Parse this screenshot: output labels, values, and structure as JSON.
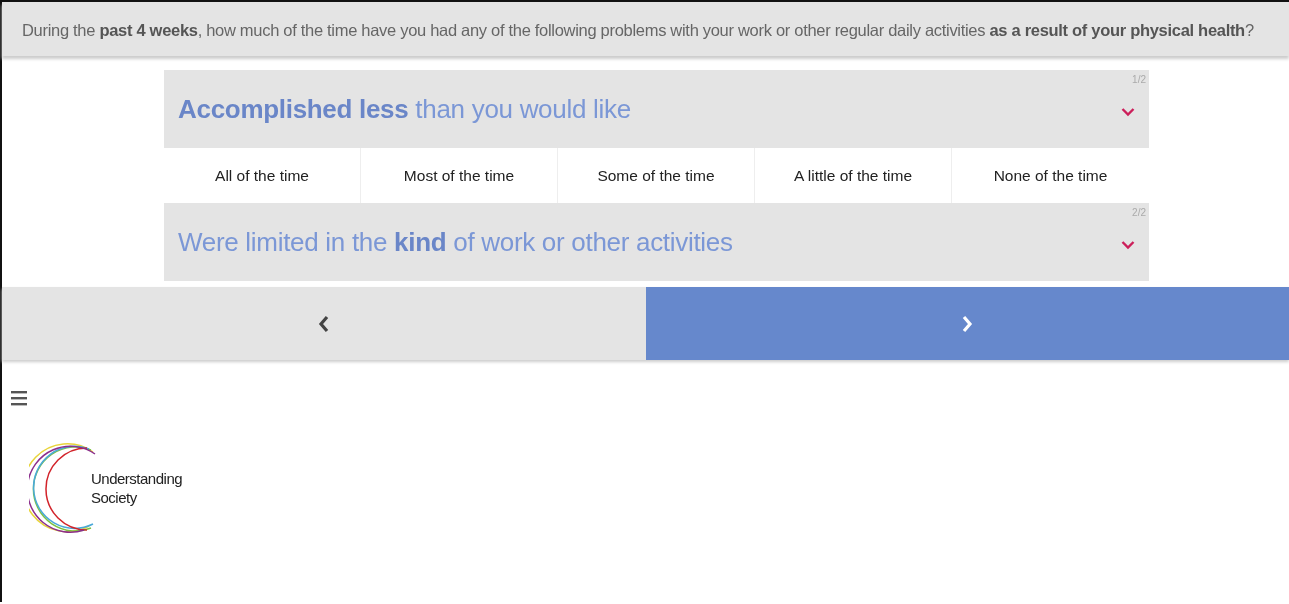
{
  "question": "During the **past 4 weeks**, how much of the time have you had any of the following problems with your work or other regular daily activities **as a result of your physical health**?",
  "items": [
    {
      "label": "**Accomplished less** than you would like",
      "counter": "1/2",
      "options": [
        {
          "label": "All of the time",
          "selected": false
        },
        {
          "label": "Most of the time",
          "selected": false
        },
        {
          "label": "Some of the time",
          "selected": false
        },
        {
          "label": "A little of the time",
          "selected": false
        },
        {
          "label": "None of the time",
          "selected": false
        }
      ]
    },
    {
      "label": "Were limited in the **kind** of work or other activities",
      "counter": "2/2"
    }
  ],
  "logo": {
    "text": "Understanding Society"
  }
}
